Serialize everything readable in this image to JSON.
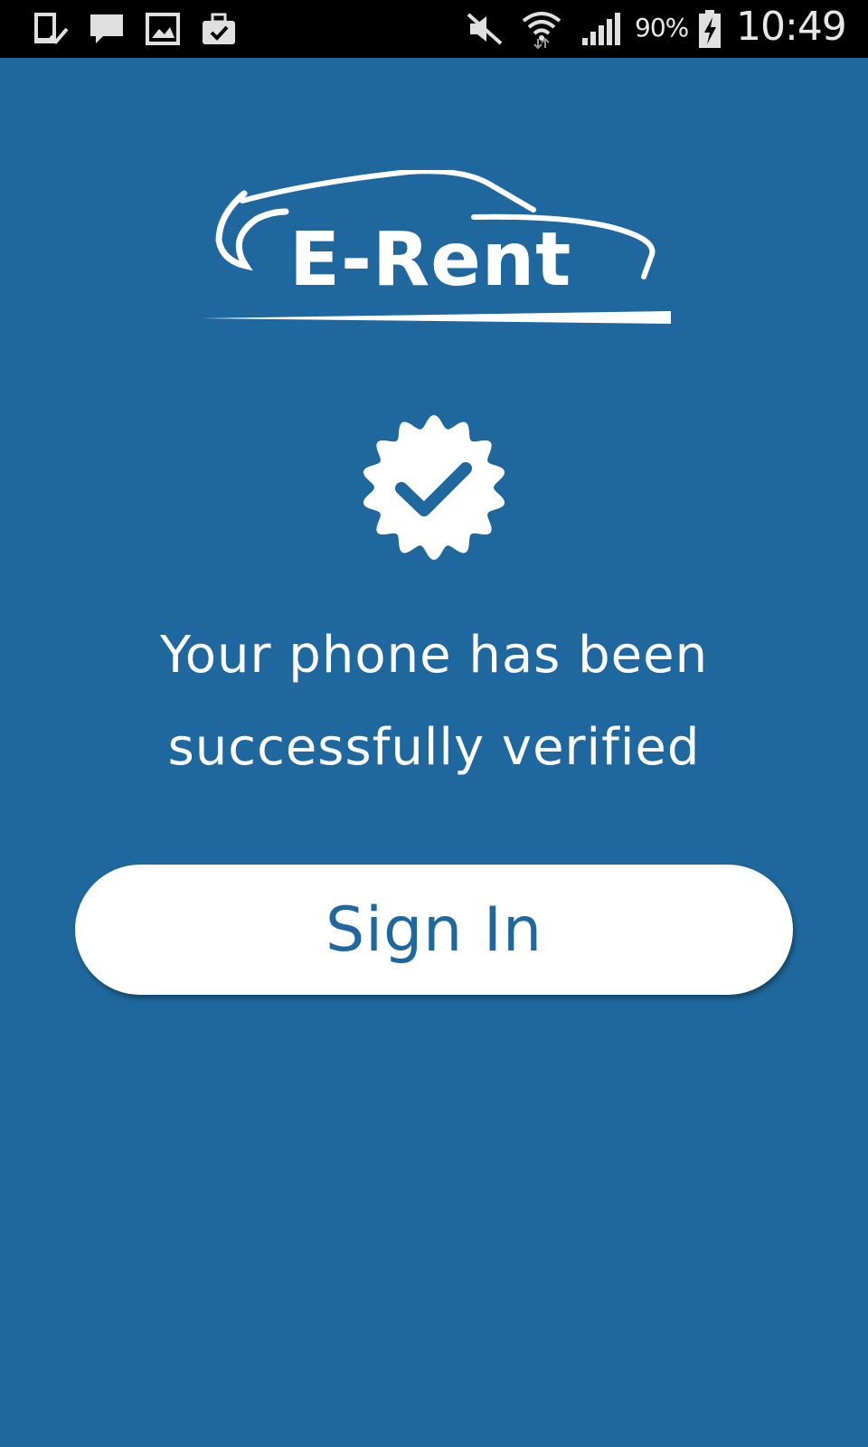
{
  "status_bar": {
    "battery_percent": "90%",
    "time": "10:49",
    "icons": [
      "download-done-icon",
      "message-icon",
      "gallery-icon",
      "briefcase-icon",
      "mute-icon",
      "wifi-icon",
      "signal-icon",
      "battery-charging-icon"
    ]
  },
  "logo": {
    "text": "E-Rent"
  },
  "verification": {
    "icon": "verified-badge-icon",
    "message_line1": "Your phone has been",
    "message_line2": "successfully verified"
  },
  "signin": {
    "label": "Sign In"
  },
  "colors": {
    "background": "#1e689f",
    "accent_text": "#1e689f",
    "foreground": "#ffffff"
  }
}
